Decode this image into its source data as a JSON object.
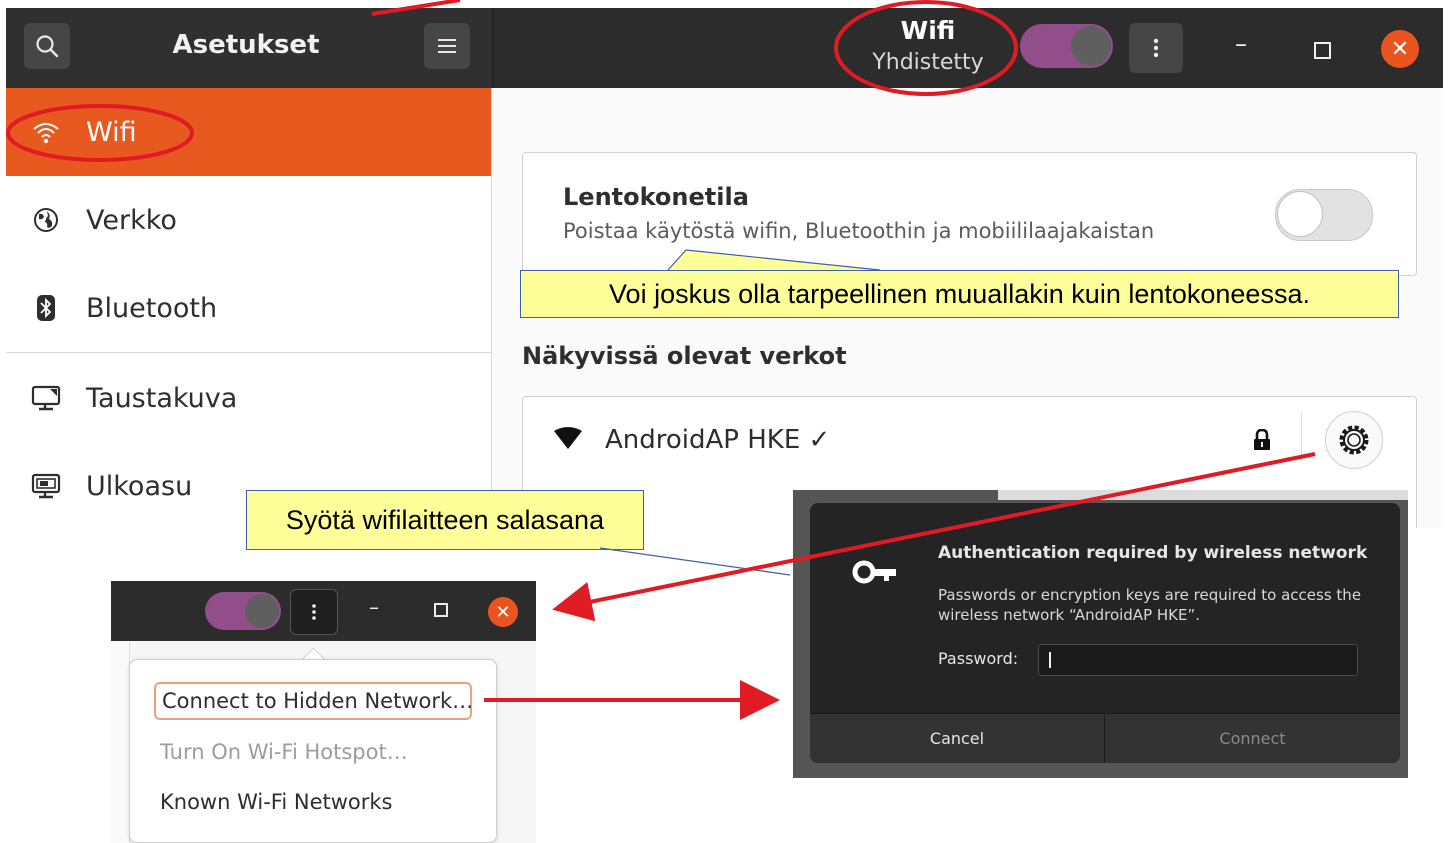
{
  "header": {
    "app_title": "Asetukset",
    "page_title": "Wifi",
    "page_status": "Yhdistetty",
    "wifi_enabled": true,
    "search_icon": "search-icon",
    "menu_icon": "hamburger-icon",
    "kebab_icon": "kebab-icon",
    "minimize_glyph": "–",
    "close_glyph": "✕"
  },
  "sidebar": {
    "items": [
      {
        "label": "Wifi",
        "icon": "wifi-icon",
        "selected": true
      },
      {
        "label": "Verkko",
        "icon": "globe-icon"
      },
      {
        "label": "Bluetooth",
        "icon": "bluetooth-icon"
      },
      {
        "label": "Taustakuva",
        "icon": "monitor-icon"
      },
      {
        "label": "Ulkoasu",
        "icon": "appearance-icon"
      }
    ]
  },
  "airplane": {
    "title": "Lentokonetila",
    "description": "Poistaa käytöstä wifin, Bluetoothin ja mobiililaajakaistan",
    "enabled": false
  },
  "networks": {
    "heading": "Näkyvissä olevat verkot",
    "items": [
      {
        "name": "AndroidAP HKE ✓",
        "connected": true,
        "secured": true
      }
    ]
  },
  "annotations": {
    "airplane_note": "Voi joskus olla tarpeellinen muuallakin kuin lentokoneessa.",
    "password_note": "Syötä wifilaitteen salasana"
  },
  "inset_menu": {
    "items": [
      {
        "label": "Connect to Hidden Network…",
        "highlighted": true
      },
      {
        "label": "Turn On Wi-Fi Hotspot…",
        "disabled": true
      },
      {
        "label": "Known Wi-Fi Networks"
      }
    ]
  },
  "auth_dialog": {
    "title": "Authentication required by wireless network",
    "description": "Passwords or encryption keys are required to access the wireless network “AndroidAP HKE”.",
    "password_label": "Password:",
    "password_value": "",
    "cancel_label": "Cancel",
    "connect_label": "Connect"
  },
  "colors": {
    "accent": "#e7591f",
    "toggle_on": "#924d8b",
    "annotation_red": "#e11b24",
    "callout_fill": "#ffff99"
  }
}
